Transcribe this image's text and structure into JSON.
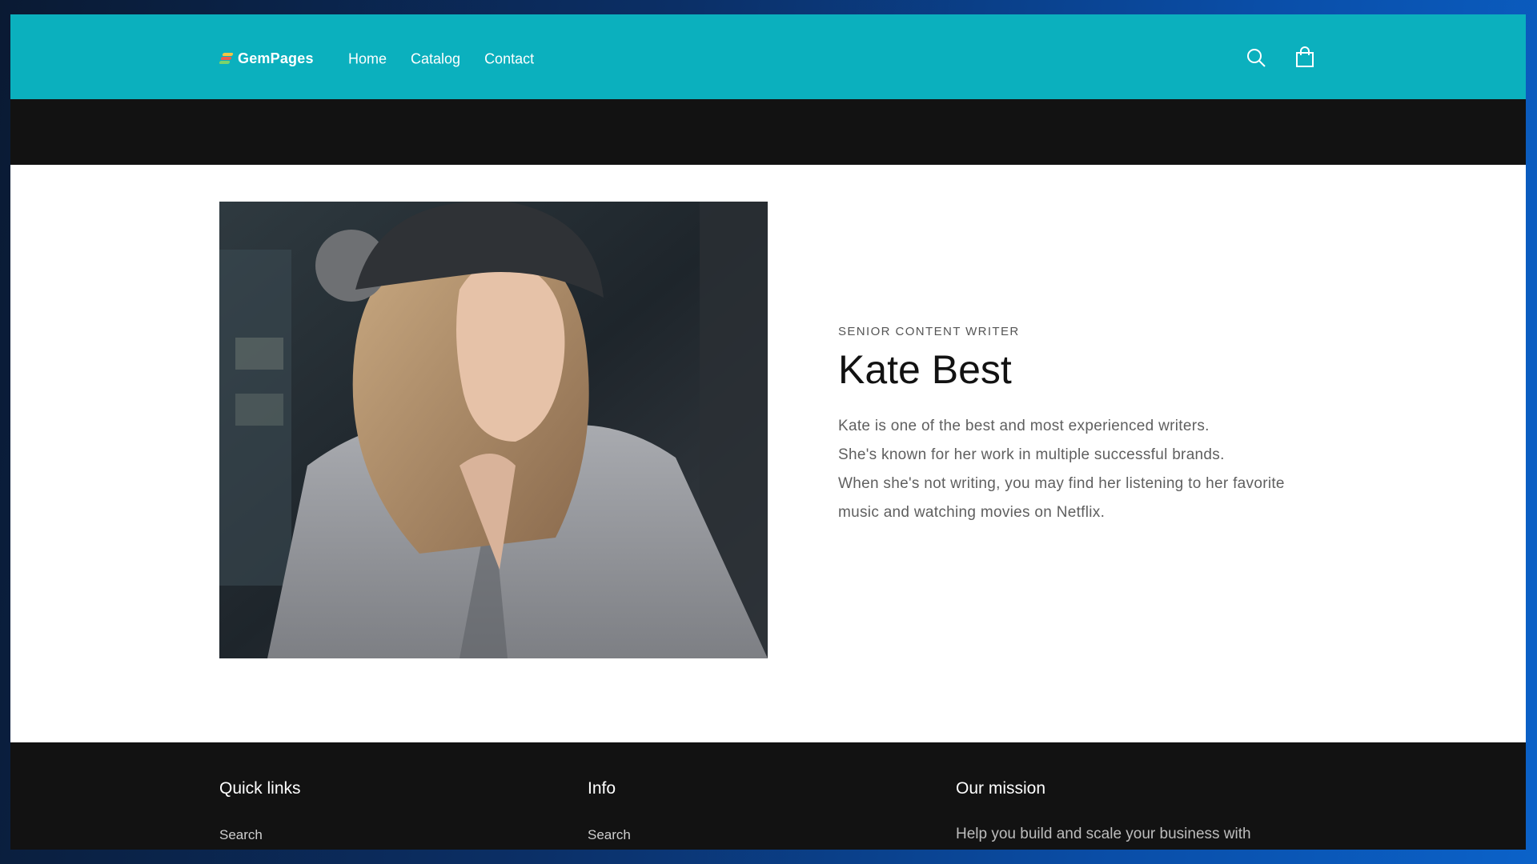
{
  "header": {
    "logo_text": "GemPages",
    "nav": [
      "Home",
      "Catalog",
      "Contact"
    ],
    "icons": [
      "search-icon",
      "cart-icon"
    ]
  },
  "profile": {
    "role": "SENIOR CONTENT WRITER",
    "name": "Kate Best",
    "bio": [
      "Kate is one of the best and most experienced writers.",
      "She's known for her work in multiple successful brands.",
      "When she's not writing, you may find her listening to her favorite",
      "music and watching movies on Netflix."
    ]
  },
  "footer": {
    "quick_links": {
      "title": "Quick links",
      "items": [
        "Search"
      ]
    },
    "info": {
      "title": "Info",
      "items": [
        "Search"
      ]
    },
    "mission": {
      "title": "Our mission",
      "text": "Help you build and scale your business with"
    }
  },
  "colors": {
    "header_bg": "#0bb0be",
    "dark_band": "#121212",
    "footer_bg": "#121212"
  }
}
